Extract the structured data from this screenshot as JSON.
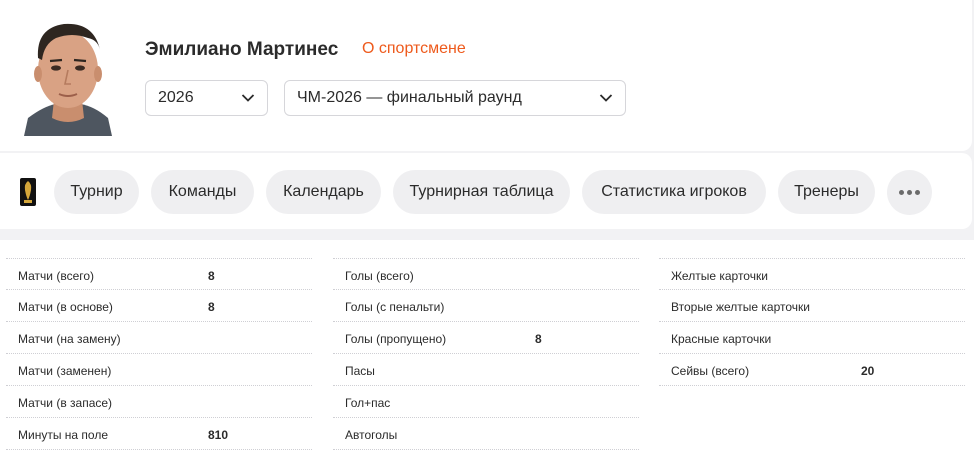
{
  "player": {
    "name": "Эмилиано Мартинес",
    "about_link": "О спортсмене"
  },
  "filters": {
    "year": "2026",
    "season": "ЧМ-2026 — финальный раунд"
  },
  "nav": {
    "tabs": [
      "Турнир",
      "Команды",
      "Календарь",
      "Турнирная таблица",
      "Статистика игроков",
      "Тренеры"
    ]
  },
  "stats": {
    "col1": [
      {
        "label": "Матчи (всего)",
        "value": "8"
      },
      {
        "label": "Матчи (в основе)",
        "value": "8"
      },
      {
        "label": "Матчи (на замену)",
        "value": ""
      },
      {
        "label": "Матчи (заменен)",
        "value": ""
      },
      {
        "label": "Матчи (в запасе)",
        "value": ""
      },
      {
        "label": "Минуты на поле",
        "value": "810"
      }
    ],
    "col2": [
      {
        "label": "Голы (всего)",
        "value": ""
      },
      {
        "label": "Голы (с пенальти)",
        "value": ""
      },
      {
        "label": "Голы (пропущено)",
        "value": "8"
      },
      {
        "label": "Пасы",
        "value": ""
      },
      {
        "label": "Гол+пас",
        "value": ""
      },
      {
        "label": "Автоголы",
        "value": ""
      }
    ],
    "col3": [
      {
        "label": "Желтые карточки",
        "value": ""
      },
      {
        "label": "Вторые желтые карточки",
        "value": ""
      },
      {
        "label": "Красные карточки",
        "value": ""
      },
      {
        "label": "Сейвы (всего)",
        "value": "20"
      }
    ]
  },
  "colors": {
    "accent": "#ee5a1c",
    "background": "#f2f2f4",
    "tab_bg": "#efeff1"
  },
  "icons": {
    "avatar": "player-photo",
    "tournament_logo": "world-cup-logo",
    "more": "more-dots-icon",
    "dropdown": "chevron-down-icon"
  }
}
